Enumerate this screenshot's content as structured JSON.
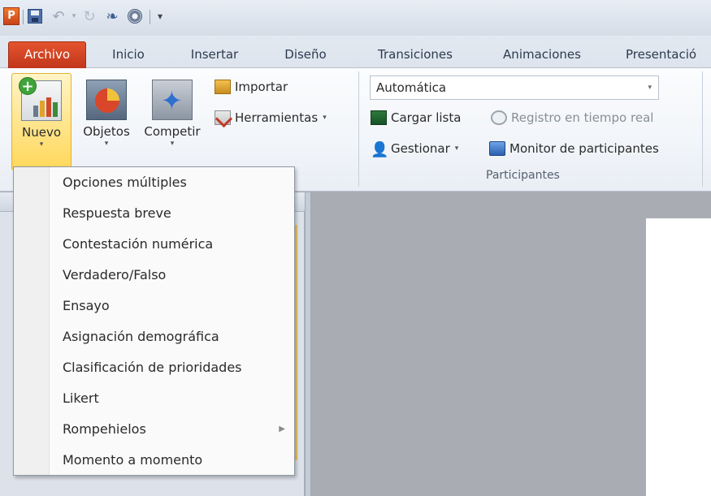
{
  "app": {
    "logo_letter": "P",
    "accent_file_tab": "#c8431a",
    "highlight": "#ffd75a"
  },
  "quick_access": {
    "icons": [
      "powerpoint-logo",
      "save-icon",
      "undo-icon",
      "redo-icon",
      "binoculars-icon",
      "gear-icon",
      "customize-icon"
    ],
    "undo_glyph": "↶",
    "undo_dropdown_glyph": "▾",
    "redo_glyph": "↻",
    "binoc_glyph": "❧",
    "customize_glyph": "▾"
  },
  "tabs": [
    {
      "label": "Archivo"
    },
    {
      "label": "Inicio"
    },
    {
      "label": "Insertar"
    },
    {
      "label": "Diseño"
    },
    {
      "label": "Transiciones"
    },
    {
      "label": "Animaciones"
    },
    {
      "label": "Presentació"
    }
  ],
  "ribbon": {
    "big_buttons": {
      "nuevo": "Nuevo",
      "objetos": "Objetos",
      "competir": "Competir",
      "arrow": "▾"
    },
    "small_buttons": {
      "importar": "Importar",
      "herramientas": "Herramientas",
      "cargar_lista": "Cargar lista",
      "registro": "Registro en tiempo real",
      "gestionar": "Gestionar",
      "monitor": "Monitor de participantes",
      "dd": "▾"
    },
    "combo": {
      "value": "Automática",
      "arrow": "▾"
    },
    "participants_group_label": "Participantes"
  },
  "menu": {
    "items": [
      {
        "label": "Opciones múltiples"
      },
      {
        "label": "Respuesta breve"
      },
      {
        "label": "Contestación numérica"
      },
      {
        "label": "Verdadero/Falso"
      },
      {
        "label": "Ensayo"
      },
      {
        "label": "Asignación demográfica"
      },
      {
        "label": "Clasificación de prioridades"
      },
      {
        "label": "Likert"
      },
      {
        "label": "Rompehielos",
        "submenu_glyph": "▶"
      },
      {
        "label": "Momento a momento"
      }
    ]
  }
}
